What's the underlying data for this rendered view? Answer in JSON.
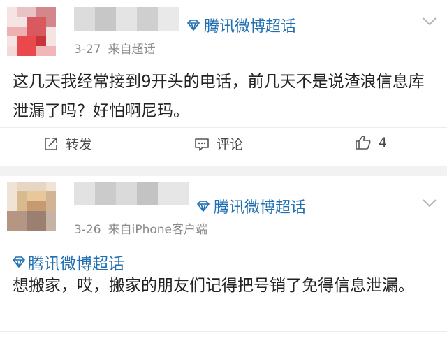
{
  "post1": {
    "topic_label": "腾讯微博超话",
    "date": "3-27",
    "source": "来自超话",
    "text": "这几天我经常接到9开头的电话，前几天不是说渣浪信息库泄漏了吗？好怕啊尼玛。",
    "actions": {
      "repost_label": "转发",
      "comment_label": "评论",
      "like_count": "4"
    }
  },
  "post2": {
    "topic_label": "腾讯微博超话",
    "date": "3-26",
    "source": "来自iPhone客户端",
    "inline_topic": "腾讯微博超话",
    "text": "想搬家，哎，搬家的朋友们记得把号销了免得信息泄漏。"
  },
  "colors": {
    "topic_blue": "#1f6fb2",
    "meta_gray": "#8a8a8a",
    "separator": "#f2f2f2"
  },
  "icons": {
    "topic": "diamond-icon",
    "expand": "chevron-down-icon",
    "repost": "share-icon",
    "comment": "comment-icon",
    "like": "thumbs-up-icon"
  }
}
